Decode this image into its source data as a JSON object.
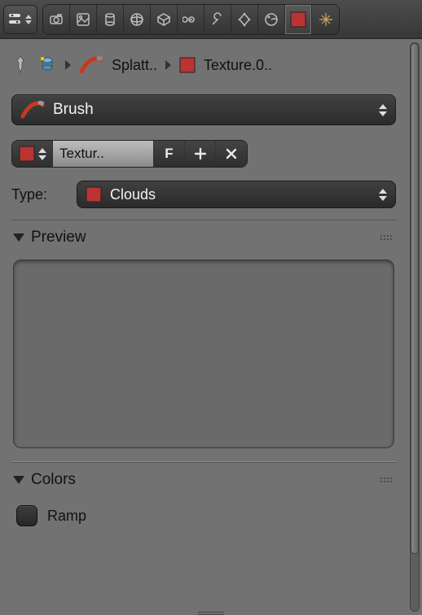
{
  "breadcrumb": {
    "item1": "Splatt..",
    "item2": "Texture.0.."
  },
  "context_dropdown": {
    "label": "Brush"
  },
  "idblock": {
    "name": "Textur..",
    "fake_user": "F",
    "add": "+",
    "remove": "×"
  },
  "type": {
    "label": "Type:",
    "value": "Clouds"
  },
  "sections": {
    "preview": "Preview",
    "colors": "Colors"
  },
  "colors": {
    "ramp": "Ramp"
  }
}
